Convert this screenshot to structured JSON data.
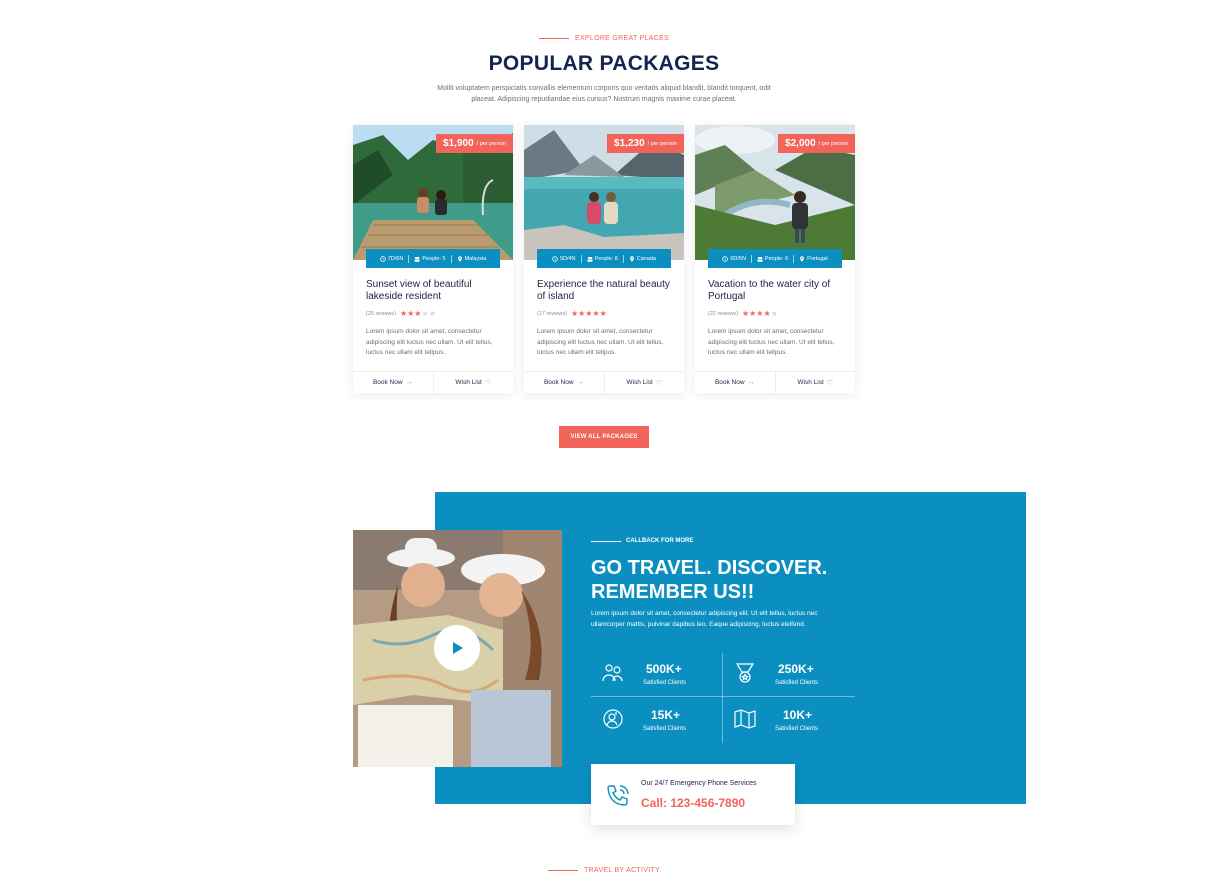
{
  "packages_section": {
    "eyebrow": "EXPLORE GREAT PLACES",
    "title": "POPULAR PACKAGES",
    "intro": "Mollit voluptatem perspiciatis convallis elementum corporis quo veritatis aliquid blandit, blandit torquent, odit placeat. Adipiscing repudiandae eius cursus? Nostrum magnis maxime curae placeat.",
    "view_all_label": "VIEW ALL PACKAGES"
  },
  "packages": [
    {
      "price": "$1,900",
      "per": "/ per person",
      "duration": "7D/6N",
      "people": "People: 5",
      "location": "Malaysia",
      "title": "Sunset view of beautiful lakeside resident",
      "reviews": "(25 reviews)",
      "rating": 3,
      "description": "Lorem ipsum dolor sit amet, consectetur adipiscing elit luctus nec ullam. Ut elit tellus, luctus nec ullam elit tellpus.",
      "book_label": "Book Now",
      "wish_label": "Wish List"
    },
    {
      "price": "$1,230",
      "per": "/ per person",
      "duration": "5D/4N",
      "people": "People: 8",
      "location": "Canada",
      "title": "Experience the natural beauty of island",
      "reviews": "(17 reviews)",
      "rating": 5,
      "description": "Lorem ipsum dolor sit amet, consectetur adipiscing elit luctus nec ullam. Ut elit tellus, luctus nec ullam elit tellpus.",
      "book_label": "Book Now",
      "wish_label": "Wish List"
    },
    {
      "price": "$2,000",
      "per": "/ per person",
      "duration": "6D/5N",
      "people": "People: 6",
      "location": "Portugal",
      "title": "Vacation to the water city of Portugal",
      "reviews": "(22 reviews)",
      "rating": 4,
      "description": "Lorem ipsum dolor sit amet, consectetur adipiscing elit luctus nec ullam. Ut elit tellus, luctus nec ullam elit tellpus.",
      "book_label": "Book Now",
      "wish_label": "Wish List"
    }
  ],
  "callback": {
    "eyebrow": "CALLBACK FOR MORE",
    "title": "GO TRAVEL. DISCOVER. REMEMBER US!!",
    "text": "Lorem ipsum dolor sit amet, consectetur adipiscing elit. Ut elit tellus, luctus nec ullamcorper mattis, pulvinar dapibus leo. Eaque adipiscing, luctus eleifend.",
    "stats": [
      {
        "icon": "clients-icon",
        "number": "500K+",
        "label": "Satisfied Clients"
      },
      {
        "icon": "medal-icon",
        "number": "250K+",
        "label": "Satisfied Clients"
      },
      {
        "icon": "support-icon",
        "number": "15K+",
        "label": "Satisfied Clients"
      },
      {
        "icon": "map-icon",
        "number": "10K+",
        "label": "Satisfied Clients"
      }
    ],
    "phone_label": "Our 24/7 Emergency Phone Services",
    "phone_number": "Call: 123-456-7890"
  },
  "next_section": {
    "eyebrow": "TRAVEL BY ACTIVITY"
  },
  "colors": {
    "accent": "#f2635a",
    "blue": "#0b8fc1",
    "navy": "#16234f"
  }
}
